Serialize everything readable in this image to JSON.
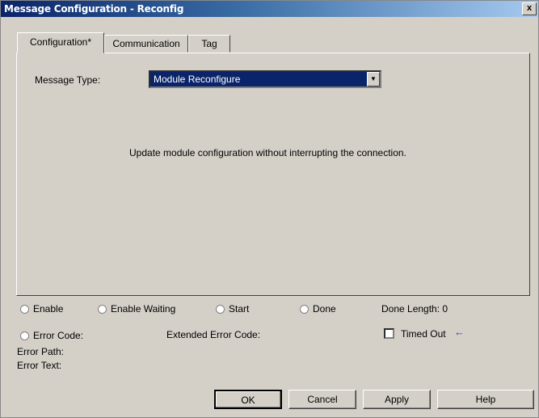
{
  "window": {
    "title": "Message Configuration - Reconfig",
    "close_label": "x"
  },
  "tabs": [
    {
      "label": "Configuration*"
    },
    {
      "label": "Communication"
    },
    {
      "label": "Tag"
    }
  ],
  "config": {
    "message_type_label": "Message Type:",
    "message_type_value": "Module Reconfigure",
    "description": "Update module configuration without interrupting the connection."
  },
  "status": {
    "enable": "Enable",
    "enable_waiting": "Enable Waiting",
    "start": "Start",
    "done": "Done",
    "done_length": "Done Length: 0",
    "error_code": "Error Code:",
    "extended_error_code": "Extended Error Code:",
    "timed_out": "Timed Out",
    "error_path": "Error Path:",
    "error_text": "Error Text:"
  },
  "buttons": {
    "ok": "OK",
    "cancel": "Cancel",
    "apply": "Apply",
    "help": "Help"
  },
  "icons": {
    "timed_out_arrow": "left-arrow-icon",
    "dropdown": "chevron-down-icon"
  },
  "colors": {
    "title_bar": "#0a246a",
    "selection": "#0a246a",
    "face": "#d4d0c8"
  }
}
